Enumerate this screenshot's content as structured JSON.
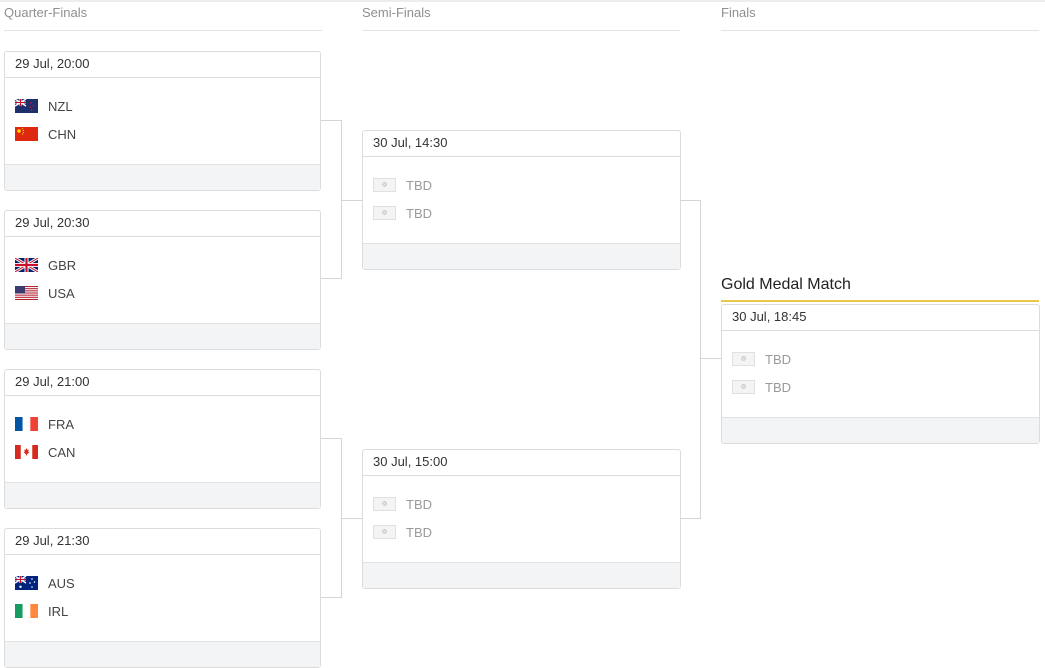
{
  "rounds": {
    "quarter_finals": "Quarter-Finals",
    "semi_finals": "Semi-Finals",
    "finals": "Finals"
  },
  "gold_medal_title": "Gold Medal Match",
  "quarter_finals": [
    {
      "date": "29 Jul, 20:00",
      "team1": {
        "code": "NZL",
        "flag": "nzl-flag-icon"
      },
      "team2": {
        "code": "CHN",
        "flag": "chn-flag-icon"
      }
    },
    {
      "date": "29 Jul, 20:30",
      "team1": {
        "code": "GBR",
        "flag": "gbr-flag-icon"
      },
      "team2": {
        "code": "USA",
        "flag": "usa-flag-icon"
      }
    },
    {
      "date": "29 Jul, 21:00",
      "team1": {
        "code": "FRA",
        "flag": "fra-flag-icon"
      },
      "team2": {
        "code": "CAN",
        "flag": "can-flag-icon"
      }
    },
    {
      "date": "29 Jul, 21:30",
      "team1": {
        "code": "AUS",
        "flag": "aus-flag-icon"
      },
      "team2": {
        "code": "IRL",
        "flag": "irl-flag-icon"
      }
    }
  ],
  "semi_finals": [
    {
      "date": "30 Jul, 14:30",
      "team1": {
        "code": "TBD",
        "flag": "placeholder-flag-icon"
      },
      "team2": {
        "code": "TBD",
        "flag": "placeholder-flag-icon"
      }
    },
    {
      "date": "30 Jul, 15:00",
      "team1": {
        "code": "TBD",
        "flag": "placeholder-flag-icon"
      },
      "team2": {
        "code": "TBD",
        "flag": "placeholder-flag-icon"
      }
    }
  ],
  "final": {
    "date": "30 Jul, 18:45",
    "team1": {
      "code": "TBD",
      "flag": "placeholder-flag-icon"
    },
    "team2": {
      "code": "TBD",
      "flag": "placeholder-flag-icon"
    }
  },
  "colors": {
    "gold_accent": "#e8c84a",
    "footer_bg": "#f3f4f6",
    "border": "#dcdcdc"
  }
}
